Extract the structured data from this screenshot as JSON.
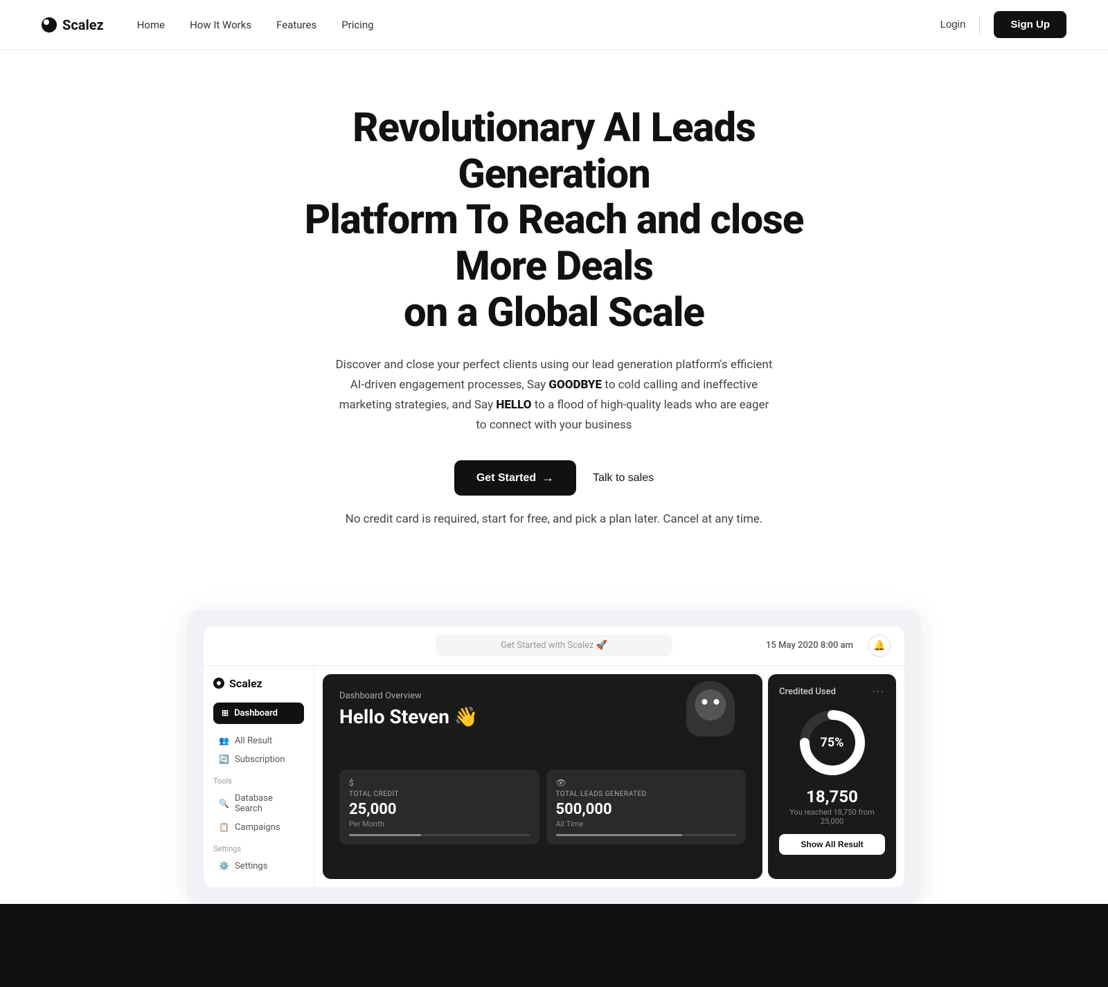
{
  "nav": {
    "logo_text": "Scalez",
    "links": [
      {
        "label": "Home",
        "id": "home"
      },
      {
        "label": "How It Works",
        "id": "how-it-works"
      },
      {
        "label": "Features",
        "id": "features"
      },
      {
        "label": "Pricing",
        "id": "pricing"
      }
    ],
    "login_label": "Login",
    "signup_label": "Sign Up"
  },
  "hero": {
    "headline_line1": "Revolutionary AI Leads Generation",
    "headline_line2": "Platform To Reach and close More Deals",
    "headline_line3": "on a Global Scale",
    "description_pre": "Discover and close your perfect clients using our lead generation platform's efficient AI-driven engagement processes, Say ",
    "goodbye_word": "GOODBYE",
    "description_mid": " to cold calling and ineffective marketing strategies, and Say ",
    "hello_word": "HELLO",
    "description_post": " to a flood of high-quality leads who are eager to connect with your business",
    "cta_primary": "Get Started",
    "cta_secondary": "Talk to sales",
    "note": "No credit card is required, start for free, and pick a plan later. Cancel at any time."
  },
  "preview": {
    "search_placeholder": "Get Started with Scalez 🚀",
    "date": "15 May 2020 8:00 am",
    "sidebar": {
      "logo": "Scalez",
      "dashboard_label": "Dashboard",
      "items": [
        {
          "label": "All Result",
          "icon": "👥"
        },
        {
          "label": "Subscription",
          "icon": "🔄"
        }
      ],
      "tools_label": "Tools",
      "tools": [
        {
          "label": "Database Search",
          "icon": "🔍"
        },
        {
          "label": "Campaigns",
          "icon": "📋"
        }
      ],
      "settings_label": "Settings",
      "settings": [
        {
          "label": "Settings",
          "icon": "⚙️"
        }
      ]
    },
    "dashboard": {
      "overview_label": "Dashboard Overview",
      "greeting": "Hello Steven 👋",
      "stats": [
        {
          "icon": "$",
          "label": "TOTAL CREDIT",
          "value": "25,000",
          "sublabel": "Per Month"
        },
        {
          "icon": "👁",
          "label": "TOTAL LEADS GENERATED",
          "value": "500,000",
          "sublabel": "All Time"
        }
      ]
    },
    "credit": {
      "title": "Credited Used",
      "dots": "···",
      "percent": "75%",
      "amount": "18,750",
      "note": "You reached 18,750 from 25,000",
      "btn_label": "Show All Result"
    }
  }
}
